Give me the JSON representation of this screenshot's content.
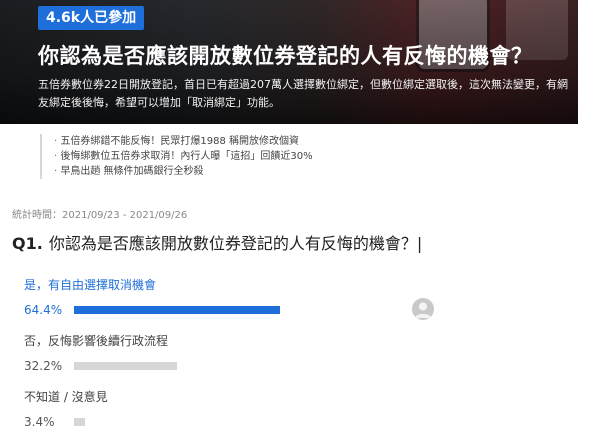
{
  "hero": {
    "badge": "4.6k人已參加",
    "title": "你認為是否應該開放數位券登記的人有反悔的機會？",
    "description": "五倍券數位券22日開放登記，首日已有超過207萬人選擇數位綁定，但數位綁定選取後，這次無法變更，有網友綁定後後悔，希望可以增加「取消綁定」功能。"
  },
  "related_articles": [
    "五倍券綁錯不能反悔！民眾打爆1988 稱開放修改個資",
    "後悔綁數位五倍券求取消！內行人曝「這招」回饋近30%",
    "早鳥出趟 無條件加碼銀行全秒殺"
  ],
  "survey_period": "統計時間：2021/09/23 - 2021/09/26",
  "question": {
    "number": "Q1.",
    "text": "你認為是否應該開放數位券登記的人有反悔的機會？|"
  },
  "options": [
    {
      "label": "是，有自由選擇取消機會",
      "percent_text": "64.4%",
      "value": 64.4,
      "selected": true
    },
    {
      "label": "否，反悔影響後續行政流程",
      "percent_text": "32.2%",
      "value": 32.2,
      "selected": false
    },
    {
      "label": "不知道 / 沒意見",
      "percent_text": "3.4%",
      "value": 3.4,
      "selected": false
    }
  ],
  "colors": {
    "accent": "#1e6fd9",
    "bar_inactive": "#d6d6d6"
  },
  "icons": {
    "voter_avatar": "user-avatar-icon"
  }
}
